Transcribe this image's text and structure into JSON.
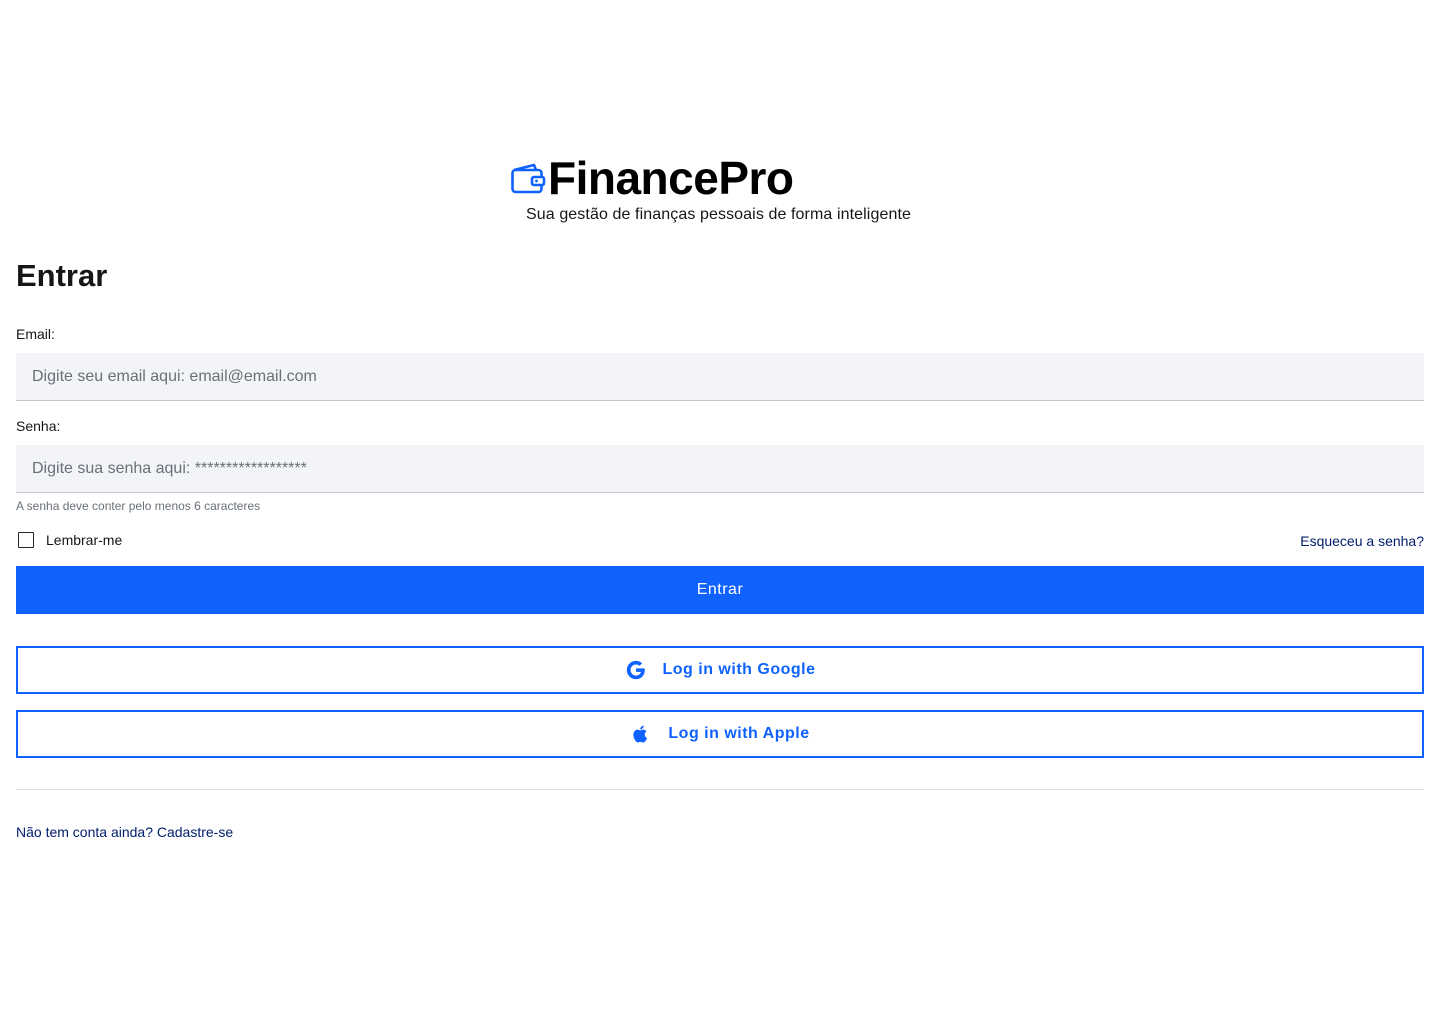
{
  "brand": {
    "name": "FinancePro",
    "tagline": "Sua gestão de finanças pessoais de forma inteligente",
    "icon": "wallet-icon"
  },
  "form": {
    "heading": "Entrar",
    "email": {
      "label": "Email:",
      "placeholder": "Digite seu email aqui: email@email.com",
      "value": ""
    },
    "password": {
      "label": "Senha:",
      "placeholder": "Digite sua senha aqui: ******************",
      "value": "",
      "helper": "A senha deve conter pelo menos 6 caracteres"
    },
    "remember_label": "Lembrar-me",
    "remember_checked": false,
    "forgot_link": "Esqueceu a senha?",
    "submit_label": "Entrar",
    "google_label": "Log in with Google",
    "google_icon": "google-icon",
    "apple_label": "Log in with Apple",
    "apple_icon": "apple-icon",
    "signup_link": "Não tem conta ainda? Cadastre-se"
  },
  "colors": {
    "primary": "#0f62fe",
    "link": "#001d6c",
    "field_bg": "#f2f4f8"
  }
}
